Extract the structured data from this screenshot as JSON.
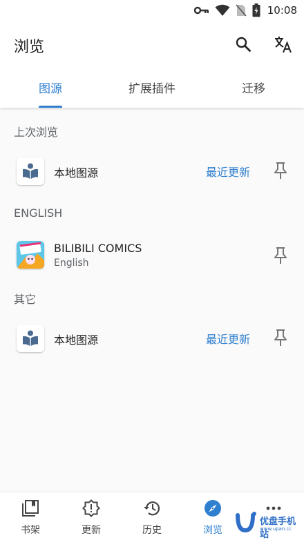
{
  "status_bar": {
    "time": "10:08",
    "icons": [
      "key-icon",
      "wifi-icon",
      "no-sim-icon",
      "battery-icon"
    ]
  },
  "app_bar": {
    "title": "浏览",
    "actions": [
      "search-icon",
      "translate-icon"
    ]
  },
  "tabs": [
    {
      "label": "图源",
      "active": true
    },
    {
      "label": "扩展插件",
      "active": false
    },
    {
      "label": "迁移",
      "active": false
    }
  ],
  "sections": {
    "last_used": {
      "header": "上次浏览",
      "items": [
        {
          "name": "本地图源",
          "latest": "最近更新"
        }
      ]
    },
    "english": {
      "header": "ENGLISH",
      "items": [
        {
          "name": "BILIBILI COMICS",
          "lang": "English"
        }
      ]
    },
    "other": {
      "header": "其它",
      "items": [
        {
          "name": "本地图源",
          "latest": "最近更新"
        }
      ]
    }
  },
  "bottom_nav": [
    {
      "label": "书架",
      "icon": "bookshelf-icon",
      "active": false
    },
    {
      "label": "更新",
      "icon": "updates-icon",
      "active": false
    },
    {
      "label": "历史",
      "icon": "history-icon",
      "active": false
    },
    {
      "label": "浏览",
      "icon": "compass-icon",
      "active": true
    },
    {
      "label": "",
      "icon": "more-icon",
      "active": false
    }
  ],
  "watermark": {
    "text": "优盘手机站",
    "url": "www.upan.cc"
  },
  "colors": {
    "accent": "#2f7fcf",
    "background": "#fafafa",
    "surface": "#ffffff"
  }
}
